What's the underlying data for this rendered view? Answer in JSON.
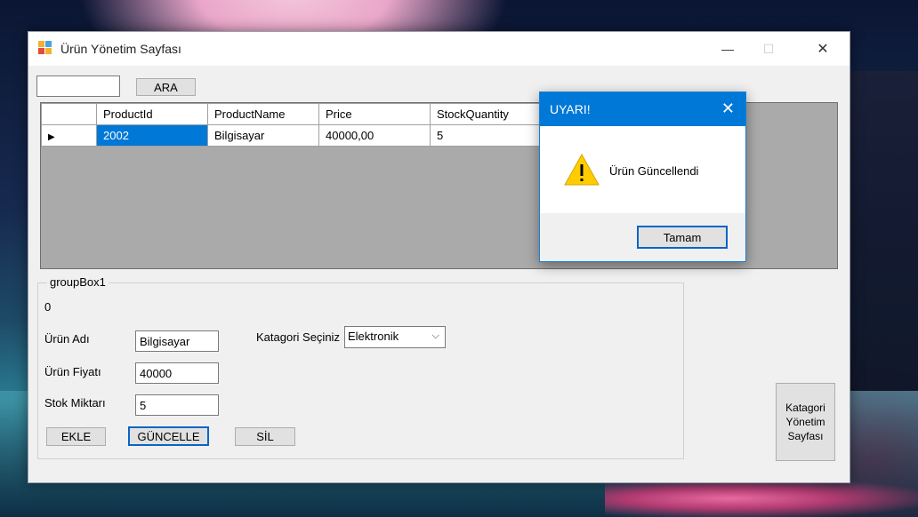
{
  "window": {
    "title": "Ürün Yönetim Sayfası"
  },
  "search": {
    "value": "",
    "button_label": "ARA"
  },
  "grid": {
    "columns": [
      "ProductId",
      "ProductName",
      "Price",
      "StockQuantity"
    ],
    "rows": [
      {
        "ProductId": "2002",
        "ProductName": "Bilgisayar",
        "Price": "40000,00",
        "StockQuantity": "5"
      }
    ]
  },
  "groupbox": {
    "title": "groupBox1",
    "id_label": "0",
    "name_label": "Ürün Adı",
    "name_value": "Bilgisayar",
    "price_label": "Ürün  Fiyatı",
    "price_value": "40000",
    "stock_label": "Stok Miktarı",
    "stock_value": "5",
    "category_label": "Katagori Seçiniz",
    "category_value": "Elektronik",
    "add_label": "EKLE",
    "update_label": "GÜNCELLE",
    "delete_label": "SİL"
  },
  "category_page_button": {
    "label": "Katagori Yönetim Sayfası"
  },
  "dialog": {
    "title": "UYARI!",
    "message": "Ürün Güncellendi",
    "ok_label": "Tamam",
    "icon": "warning-icon"
  },
  "colors": {
    "accent": "#0078d7",
    "selection": "#0078d7",
    "warning": "#ffcc00"
  }
}
